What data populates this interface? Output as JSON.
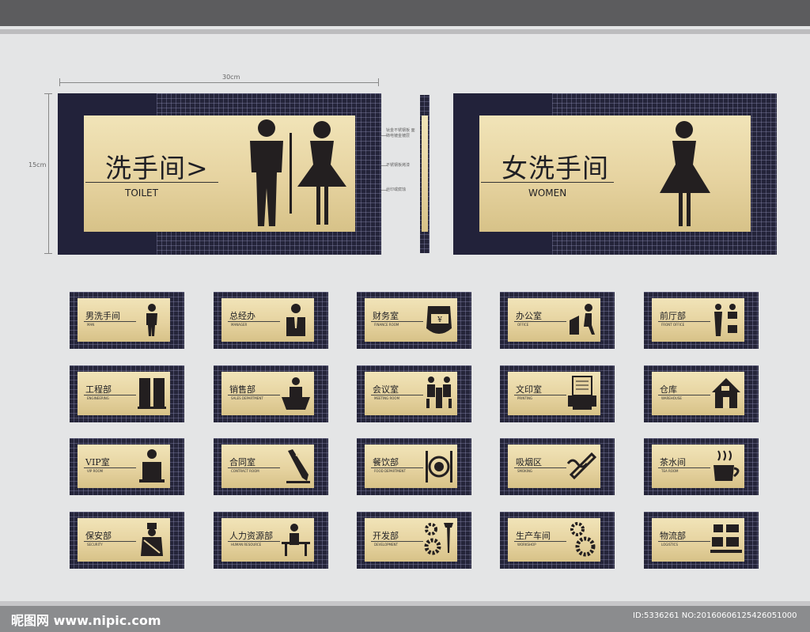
{
  "dimensions": {
    "width_label": "30cm",
    "height_label": "15cm"
  },
  "main_signs": [
    {
      "cn": "洗手间>",
      "en": "TOILET",
      "icon": "man-woman-icon"
    },
    {
      "cn": "女洗手间",
      "en": "WOMEN",
      "icon": "woman-icon"
    }
  ],
  "side_notes": [
    "钛金不锈钢板 面饰电镀金镀层",
    "不锈钢板烤漆",
    "丝印或腐蚀"
  ],
  "signs": [
    {
      "cn": "男洗手间",
      "en": "MAN",
      "icon": "man-icon"
    },
    {
      "cn": "总经办",
      "en": "MANAGER",
      "icon": "manager-icon"
    },
    {
      "cn": "财务室",
      "en": "FINANCE ROOM",
      "icon": "money-hand-icon"
    },
    {
      "cn": "办公室",
      "en": "OFFICE",
      "icon": "office-worker-icon"
    },
    {
      "cn": "前厅部",
      "en": "FRONT OFFICE",
      "icon": "front-desk-icon"
    },
    {
      "cn": "工程部",
      "en": "ENGINEERING",
      "icon": "lockers-icon"
    },
    {
      "cn": "销售部",
      "en": "SALES DEPARTMENT",
      "icon": "salesperson-icon"
    },
    {
      "cn": "会议室",
      "en": "MEETING ROOM",
      "icon": "meeting-icon"
    },
    {
      "cn": "文印室",
      "en": "PRINTING",
      "icon": "printer-icon"
    },
    {
      "cn": "仓库",
      "en": "WAREHOUSE",
      "icon": "house-icon"
    },
    {
      "cn": "VIP室",
      "en": "VIP ROOM",
      "icon": "vip-person-icon"
    },
    {
      "cn": "合同室",
      "en": "CONTRACT ROOM",
      "icon": "pencil-icon"
    },
    {
      "cn": "餐饮部",
      "en": "FOOD DEPARTMENT",
      "icon": "cutlery-icon"
    },
    {
      "cn": "吸烟区",
      "en": "SMOKING",
      "icon": "cigarette-icon"
    },
    {
      "cn": "茶水间",
      "en": "TEA ROOM",
      "icon": "tea-cup-icon"
    },
    {
      "cn": "保安部",
      "en": "SECURITY",
      "icon": "guard-icon"
    },
    {
      "cn": "人力资源部",
      "en": "HUMAN RESOURCE",
      "icon": "desk-worker-icon"
    },
    {
      "cn": "开发部",
      "en": "DEVELOPMENT",
      "icon": "gears-wrench-icon"
    },
    {
      "cn": "生产车间",
      "en": "WORKSHOP",
      "icon": "gears-icon"
    },
    {
      "cn": "物流部",
      "en": "LOGISTICS",
      "icon": "boxes-icon"
    }
  ],
  "footer": {
    "watermark": "昵图网 www.nipic.com",
    "id_text": "ID:5336261 NO:20160606125426051000"
  },
  "colors": {
    "frame": "#25253a",
    "gold": "#e6d3a0",
    "ink": "#1f1f24"
  }
}
